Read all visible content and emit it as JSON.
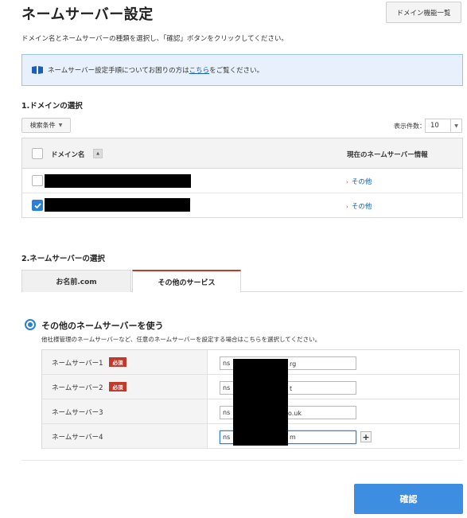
{
  "header": {
    "title": "ネームサーバー設定",
    "domain_list_button": "ドメイン機能一覧"
  },
  "intro_text": "ドメイン名とネームサーバーの種類を選択し、「確認」ボタンをクリックしてください。",
  "info_box": {
    "icon": "book-icon",
    "text_before": "ネームサーバー設定手順についてお困りの方は",
    "link_text": "こちら",
    "text_after": "をご覧ください。"
  },
  "section1": {
    "title": "1.ドメインの選択",
    "search_conditions_label": "検索条件",
    "display_count_label": "表示件数：",
    "display_count_value": "10",
    "table": {
      "col_domain": "ドメイン名",
      "col_sort_icon": "sort-up-icon",
      "col_ns_info": "現在のネームサーバー情報",
      "rows": [
        {
          "checked": false,
          "ns_info": "その他"
        },
        {
          "checked": true,
          "ns_info": "その他"
        }
      ]
    }
  },
  "section2": {
    "title": "2.ネームサーバーの選択",
    "tabs": [
      {
        "label": "お名前.com",
        "active": false
      },
      {
        "label": "その他のサービス",
        "active": true
      }
    ],
    "option_label": "その他のネームサーバーを使う",
    "option_description": "他社様管理のネームサーバーなど、任意のネームサーバーを設定する場合はこちらを選択してください。",
    "required_badge": "必須",
    "nameservers": [
      {
        "label": "ネームサーバー1",
        "required": true,
        "value_prefix": "ns",
        "value_suffix": "rg"
      },
      {
        "label": "ネームサーバー2",
        "required": true,
        "value_prefix": "ns",
        "value_suffix": "t"
      },
      {
        "label": "ネームサーバー3",
        "required": false,
        "value_prefix": "ns",
        "value_suffix": "o.uk"
      },
      {
        "label": "ネームサーバー4",
        "required": false,
        "value_prefix": "ns",
        "value_suffix": "m"
      }
    ],
    "add_button_icon": "plus-icon"
  },
  "confirm_button": "確認",
  "colors": {
    "accent_blue": "#3d8de0",
    "required_red": "#c0392b",
    "info_bg": "#e8f1fb"
  }
}
